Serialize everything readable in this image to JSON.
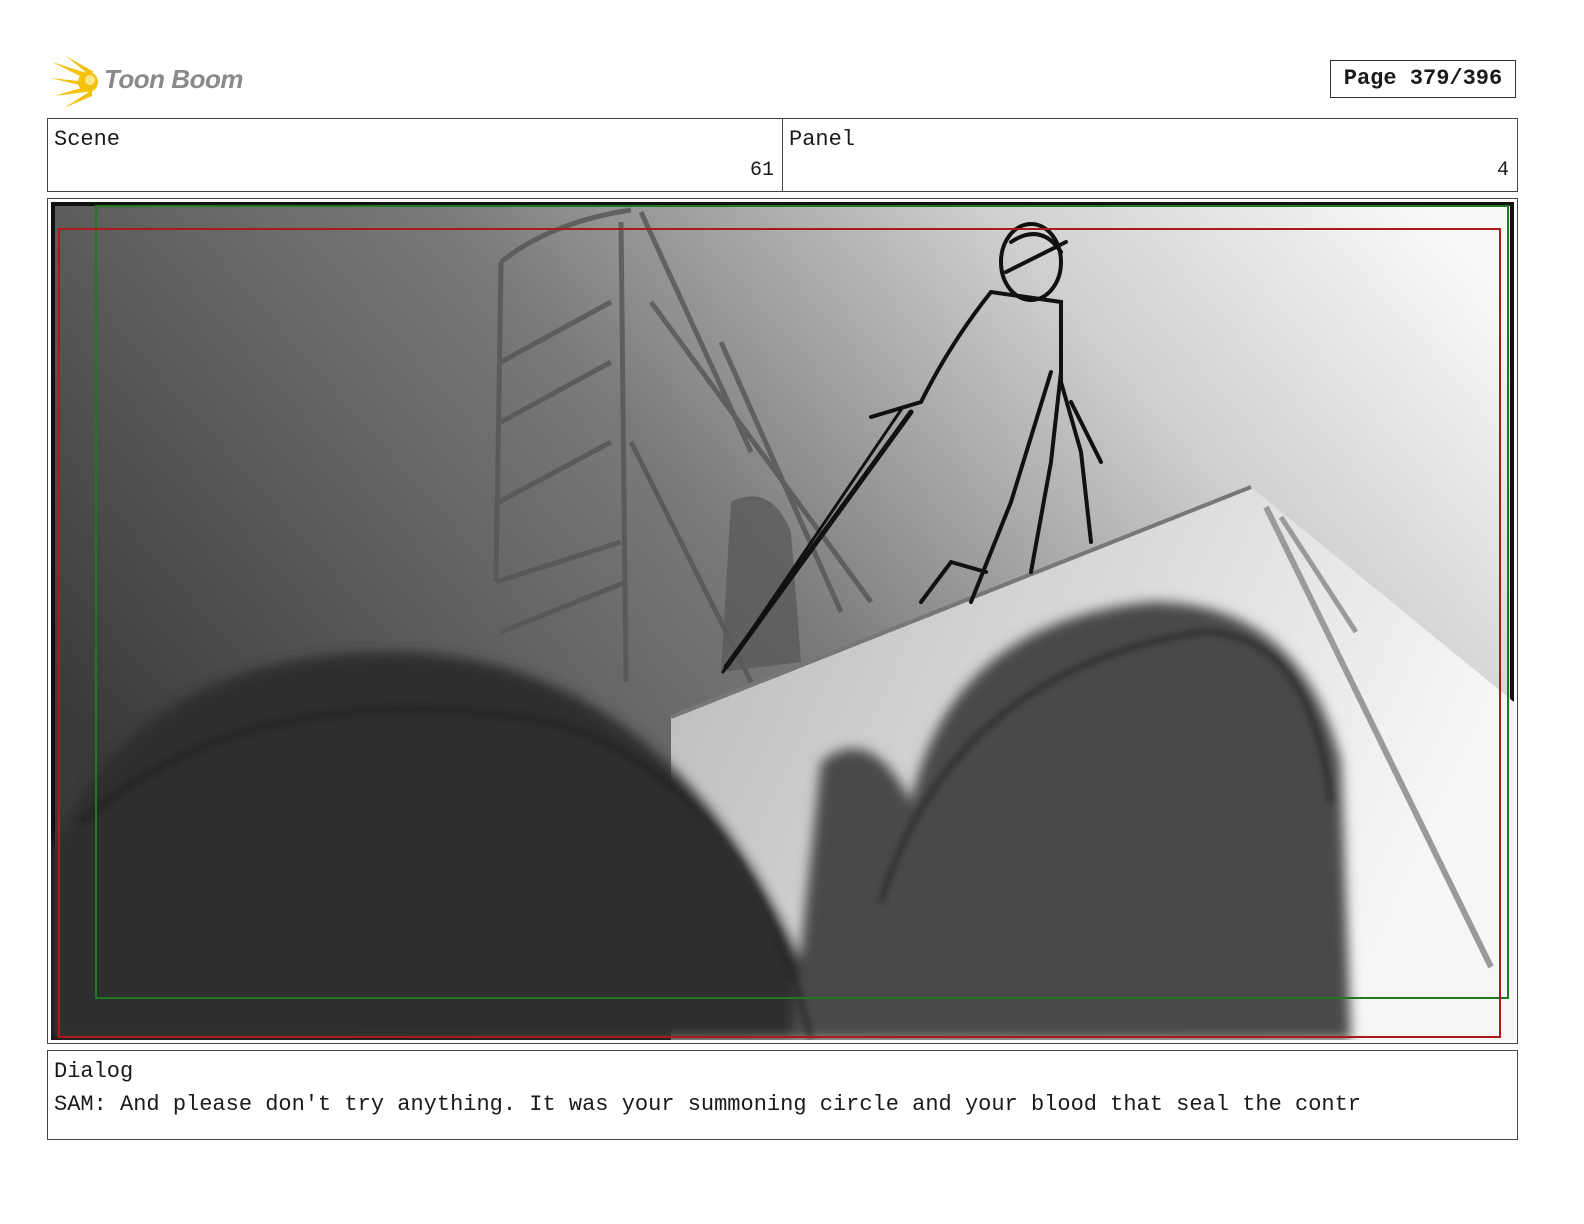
{
  "header": {
    "logo_text": "Toon Boom",
    "page_label": "Page 379/396"
  },
  "scene": {
    "label": "Scene",
    "value": "61"
  },
  "panel": {
    "label": "Panel",
    "value": "4"
  },
  "dialog": {
    "label": "Dialog",
    "text": "SAM: And please don't try anything. It was your summoning circle and your blood that seal the contr"
  },
  "colors": {
    "safe_frame_red": "#b01818",
    "title_safe_green": "#1f7a1f",
    "logo_yellow": "#f4c20d"
  }
}
